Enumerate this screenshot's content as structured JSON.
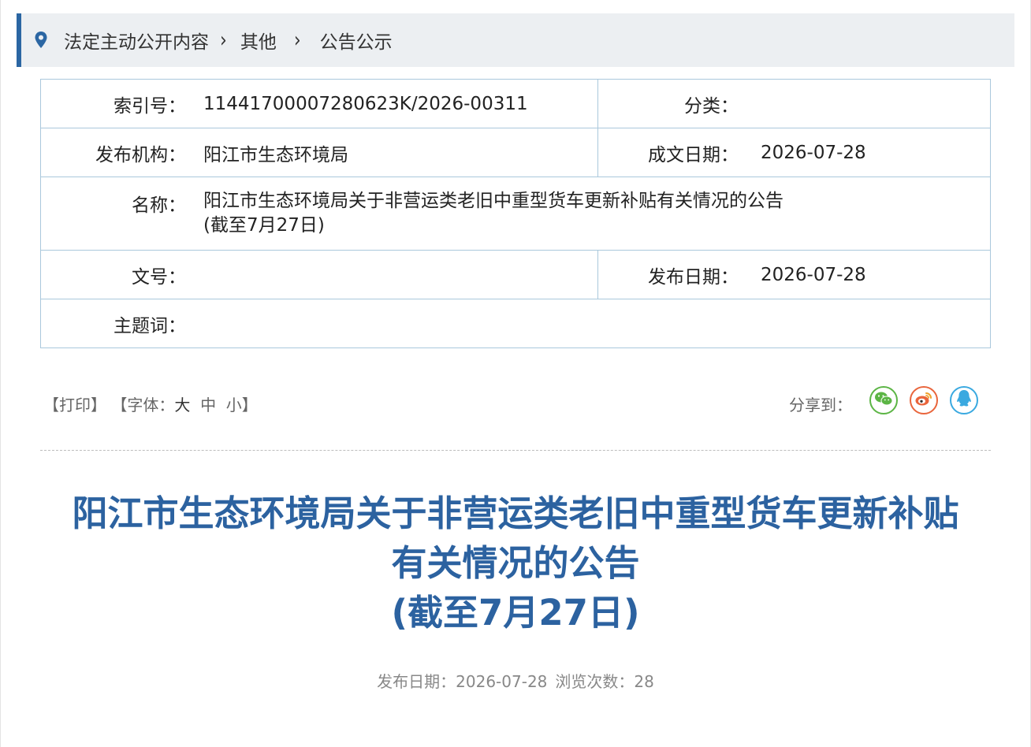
{
  "breadcrumb": {
    "items": [
      "法定主动公开内容",
      "其他",
      "公告公示"
    ],
    "separator": "›"
  },
  "info": {
    "index_label": "索引号：",
    "index_value": "11441700007280623K/2026-00311",
    "category_label": "分类：",
    "category_value": "",
    "publisher_label": "发布机构：",
    "publisher_value": "阳江市生态环境局",
    "written_date_label": "成文日期：",
    "written_date_value": "2026-07-28",
    "name_label": "名称：",
    "name_line1": "阳江市生态环境局关于非营运类老旧中重型货车更新补贴有关情况的公告",
    "name_line2": "(截至7月27日)",
    "doc_no_label": "文号：",
    "doc_no_value": "",
    "publish_date_label": "发布日期：",
    "publish_date_value": "2026-07-28",
    "keywords_label": "主题词：",
    "keywords_value": ""
  },
  "toolbar": {
    "print": "【打印】",
    "font_open": "【字体：",
    "font_large": "大",
    "font_medium": "中",
    "font_small": "小",
    "font_close": "】",
    "share_label": "分享到："
  },
  "share_icons": [
    "wechat-icon",
    "weibo-icon",
    "qq-icon"
  ],
  "article": {
    "title_line1": "阳江市生态环境局关于非营运类老旧中重型货车更新补贴",
    "title_line2": "有关情况的公告",
    "title_line3": "(截至7月27日)",
    "date_label": "发布日期：",
    "date_value": "2026-07-28",
    "views_label": "浏览次数：",
    "views_value": "28"
  },
  "colors": {
    "accent": "#2b66a3",
    "title": "#2c62a0",
    "table_border": "#aac8dc",
    "wechat": "#5cb545",
    "weibo": "#e9653c",
    "qq": "#3aa9e0"
  }
}
